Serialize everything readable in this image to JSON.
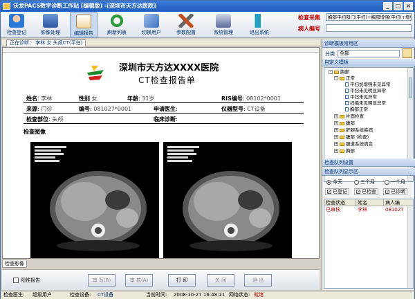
{
  "window": {
    "title": "沃龙PACS数字诊断工作站 [编辑版] -[深圳市天方达医院]",
    "min_label": "_",
    "max_label": "□",
    "close_label": "×"
  },
  "toolbar": {
    "items": [
      {
        "label": "检查登记",
        "color": "#2a7ad8"
      },
      {
        "label": "影像处理",
        "color": "#4b7fc4"
      },
      {
        "label": "编辑报告",
        "color": "#e09020"
      },
      {
        "label": "刷新列表",
        "color": "#2a9a3a"
      },
      {
        "label": "切换用户",
        "color": "#3a6fc0"
      },
      {
        "label": "参数配置",
        "color": "#c05020"
      },
      {
        "label": "系统管理",
        "color": "#5a6a9a"
      },
      {
        "label": "退出系统",
        "color": "#20a0c0"
      }
    ]
  },
  "check_area": {
    "method_label": "检查采集",
    "method_value": "胸部平扫部门(平扫)+胸部增强(平扫)+增强(平扫)",
    "id_label": "病人编号"
  },
  "doc_tab": {
    "label": "正在诊断： 李林  女  头颅CT(平扫)"
  },
  "report": {
    "hospital": "深圳市天方达XXXX医院",
    "report_title": "CT检查报告单",
    "row1": {
      "name_label": "姓名",
      "name": "李林",
      "sex_label": "性别",
      "sex": "女",
      "age_label": "年龄",
      "age": "31岁",
      "ris_label": "RIS编号",
      "ris": "08102*0001"
    },
    "row2": {
      "source_label": "来源",
      "source": "门诊",
      "no_label": "编号",
      "no": "081027*0001",
      "doctor_label": "申请医生",
      "device_label": "仪器型号",
      "device": "CT设备"
    },
    "row3": {
      "part_label": "检查部位",
      "part": "头颅",
      "diag_label": "临床诊断"
    },
    "image_label": "检查图像"
  },
  "bottom_tab": "检查影像",
  "buttons": {
    "positive_label": "阳性报告",
    "review": "审 写(R)",
    "audit": "审 核(A)",
    "print": "打 印",
    "close": "关 闭",
    "exit": "退 出"
  },
  "right_panel": {
    "template_title": "诊断模板常用区",
    "category_label": "分类",
    "category_value": "全部",
    "custom_title": "自定义模板",
    "tree": [
      {
        "type": "fld",
        "indent": 1,
        "label": "胸部"
      },
      {
        "type": "fld",
        "indent": 2,
        "label": "正常"
      },
      {
        "type": "doc",
        "indent": 3,
        "label": "平扫加增强未见异常"
      },
      {
        "type": "doc",
        "indent": 3,
        "label": "平扫未见明显异常"
      },
      {
        "type": "doc",
        "indent": 3,
        "label": "平扫未见异常"
      },
      {
        "type": "doc",
        "indent": 3,
        "label": "扫描未见明显异常"
      },
      {
        "type": "doc",
        "indent": 3,
        "label": "胸部正常"
      },
      {
        "type": "fld",
        "indent": 1,
        "label": "片面检查"
      },
      {
        "type": "fld",
        "indent": 1,
        "label": "腹部"
      },
      {
        "type": "fld",
        "indent": 1,
        "label": "肝胆系统疾病"
      },
      {
        "type": "fld",
        "indent": 1,
        "label": "腹部 (检查)"
      },
      {
        "type": "fld",
        "indent": 1,
        "label": "胆道系统病变"
      },
      {
        "type": "fld",
        "indent": 1,
        "label": "胸部"
      }
    ],
    "check_title": "检查队列设置",
    "list_title": "检查队列显示区",
    "radios": [
      "今天",
      "三个月",
      "一个月"
    ],
    "checks": [
      "已登记",
      "已检查",
      "已诊断"
    ],
    "cols": [
      "检查状态",
      "姓名",
      "病人编"
    ],
    "row": {
      "status": "已审核",
      "name": "李林",
      "id": "081027"
    }
  },
  "status": {
    "dept_label": "检查医生:",
    "dept": "超级用户",
    "device_label": "检查设备:",
    "device": "CT设备",
    "time_label": "当前时间:",
    "time": "2008-10-27 16:48:21",
    "net_label": "网络状态:",
    "net": "就绪"
  },
  "colors": {
    "accent": "#1f5cbf",
    "alert": "#c00000",
    "link": "#00307a"
  }
}
